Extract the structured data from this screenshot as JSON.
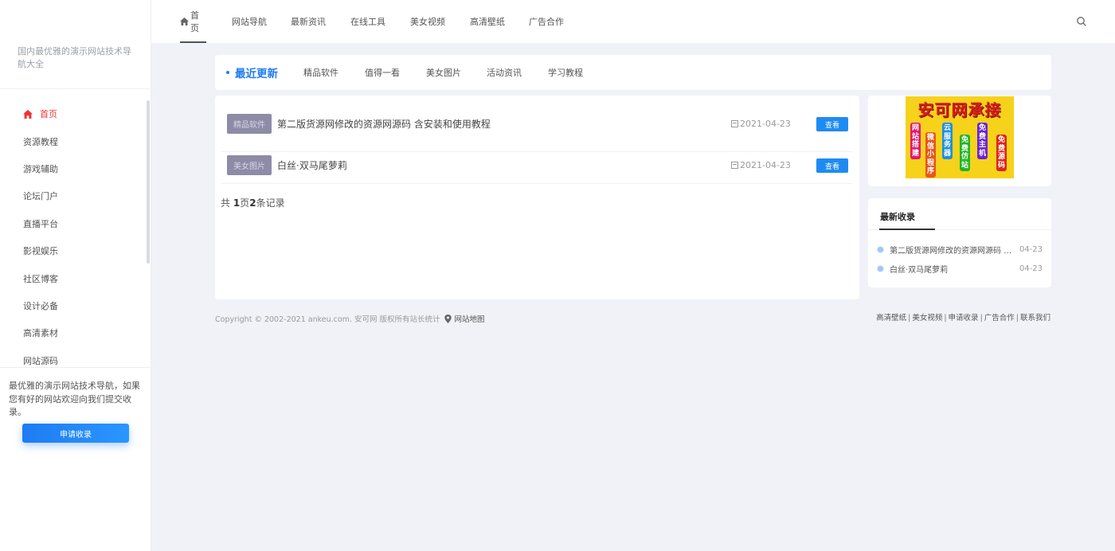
{
  "sidebar": {
    "tagline": "国内最优雅的演示网站技术导航大全",
    "items": [
      {
        "label": "首页"
      },
      {
        "label": "资源教程"
      },
      {
        "label": "游戏辅助"
      },
      {
        "label": "论坛门户"
      },
      {
        "label": "直播平台"
      },
      {
        "label": "影视娱乐"
      },
      {
        "label": "社区博客"
      },
      {
        "label": "设计必备"
      },
      {
        "label": "高清素材"
      },
      {
        "label": "网站源码"
      }
    ],
    "promo_text": "最优雅的演示网站技术导航，如果您有好的网站欢迎向我们提交收录。",
    "apply_label": "申请收录"
  },
  "topnav": {
    "items": [
      {
        "label": "首页",
        "icon": "home-icon"
      },
      {
        "label": "网站导航"
      },
      {
        "label": "最新资讯"
      },
      {
        "label": "在线工具"
      },
      {
        "label": "美女视频"
      },
      {
        "label": "高清壁纸"
      },
      {
        "label": "广告合作"
      }
    ]
  },
  "tabs": [
    {
      "label": "最近更新"
    },
    {
      "label": "精品软件"
    },
    {
      "label": "值得一看"
    },
    {
      "label": "美女图片"
    },
    {
      "label": "活动资讯"
    },
    {
      "label": "学习教程"
    }
  ],
  "list": {
    "rows": [
      {
        "category": "精品软件",
        "title": "第二版货源网修改的资源网源码 含安装和使用教程",
        "date": "2021-04-23",
        "action": "查看"
      },
      {
        "category": "美女图片",
        "title": "白丝·双马尾萝莉",
        "date": "2021-04-23",
        "action": "查看"
      }
    ],
    "pager": {
      "prefix": "共 ",
      "pages": "1",
      "mid": "页",
      "records": "2",
      "suffix": "条记录"
    }
  },
  "ad": {
    "title": "安可网承接",
    "pills": [
      "网站搭建",
      "微信小程序",
      "云服务器",
      "免费仿站",
      "免费主机",
      "免费源码"
    ],
    "colors": [
      "#e6176f",
      "#e8561c",
      "#1d8fe0",
      "#22b52a",
      "#6a24d8",
      "#e0251b"
    ]
  },
  "recent": {
    "heading": "最新收录",
    "items": [
      {
        "title": "第二版货源网修改的资源网源码 含安装和使用教程",
        "date": "04-23"
      },
      {
        "title": "白丝·双马尾萝莉",
        "date": "04-23"
      }
    ]
  },
  "footer": {
    "copyright": "Copyright © 2002-2021 ankeu.com. 安可网 版权所有站长统计",
    "sitemap": "网站地图",
    "links": [
      "高清壁纸",
      "美女视频",
      "申请收录",
      "广告合作",
      "联系我们"
    ]
  },
  "accent_color": "#1e7cf2"
}
